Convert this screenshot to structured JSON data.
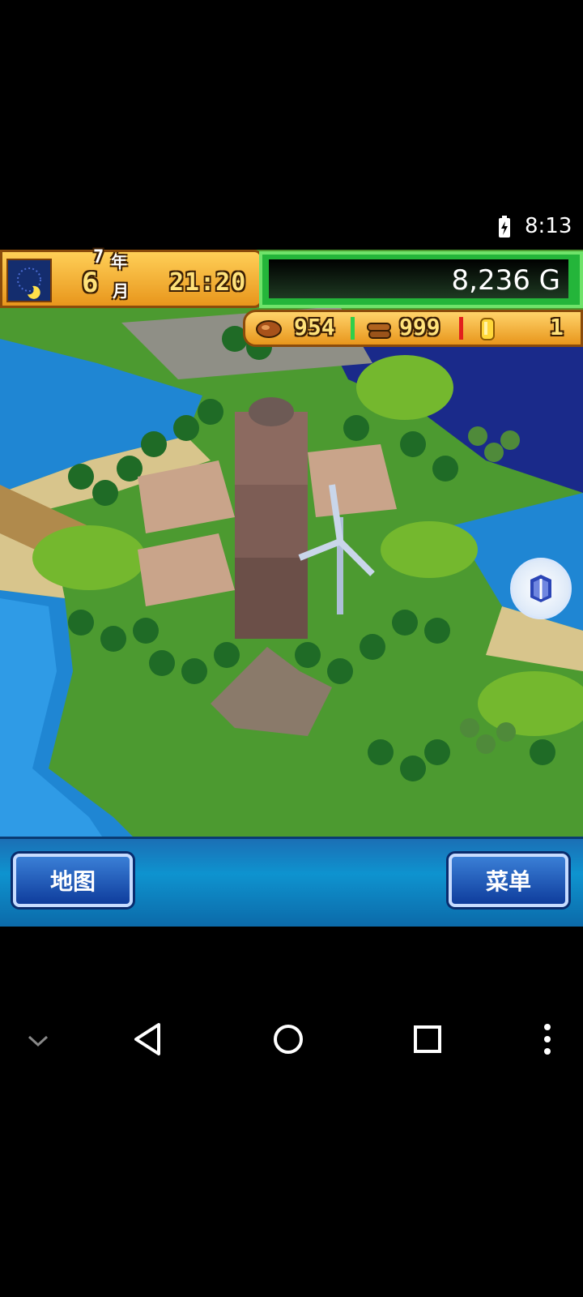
{
  "status_bar": {
    "time": "8:13",
    "battery_icon": "battery-charging-icon"
  },
  "hud": {
    "year": "7",
    "year_unit": "年",
    "month": "6",
    "month_unit": "月",
    "time": "21:20",
    "money": "8,236 G",
    "resources": [
      {
        "icon": "food-icon",
        "value": "954",
        "bar_color": "#2fcf4a"
      },
      {
        "icon": "wood-icon",
        "value": "999",
        "bar_color": "#e2201c"
      },
      {
        "icon": "coin-icon",
        "value": "1"
      }
    ],
    "weather_icon": "night-moon-icon"
  },
  "buttons": {
    "map": "地图",
    "menu": "菜单"
  },
  "nav": [
    "chevron-down-icon",
    "back-icon",
    "home-icon",
    "recents-icon",
    "more-icon"
  ]
}
